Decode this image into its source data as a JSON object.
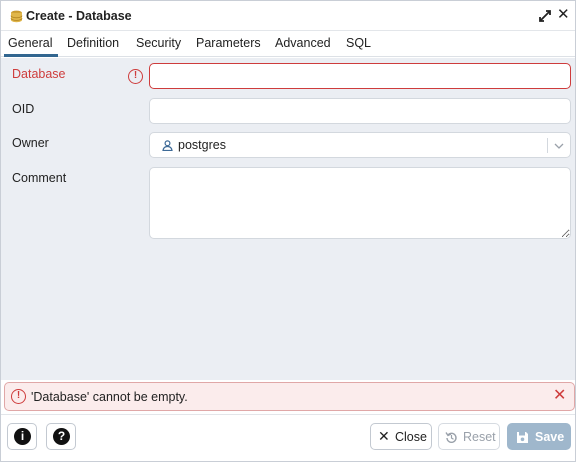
{
  "dialog": {
    "title": "Create - Database",
    "icons": {
      "title": "database-icon",
      "expand": "expand-icon",
      "close": "close-icon"
    }
  },
  "tabs": [
    {
      "label": "General",
      "active": true
    },
    {
      "label": "Definition"
    },
    {
      "label": "Security"
    },
    {
      "label": "Parameters"
    },
    {
      "label": "Advanced"
    },
    {
      "label": "SQL"
    }
  ],
  "form": {
    "database": {
      "label": "Database",
      "value": "",
      "invalid": true
    },
    "oid": {
      "label": "OID",
      "value": ""
    },
    "owner": {
      "label": "Owner",
      "value": "postgres"
    },
    "comment": {
      "label": "Comment",
      "value": ""
    }
  },
  "error": {
    "message": "'Database' cannot be empty.",
    "close_glyph": "✕"
  },
  "footer": {
    "info_glyph": "i",
    "help_glyph": "?",
    "close_label": "Close",
    "reset_label": "Reset",
    "save_label": "Save"
  },
  "colors": {
    "accent": "#326690",
    "error": "#ce3c3c",
    "save_disabled": "#9fb7cc"
  }
}
